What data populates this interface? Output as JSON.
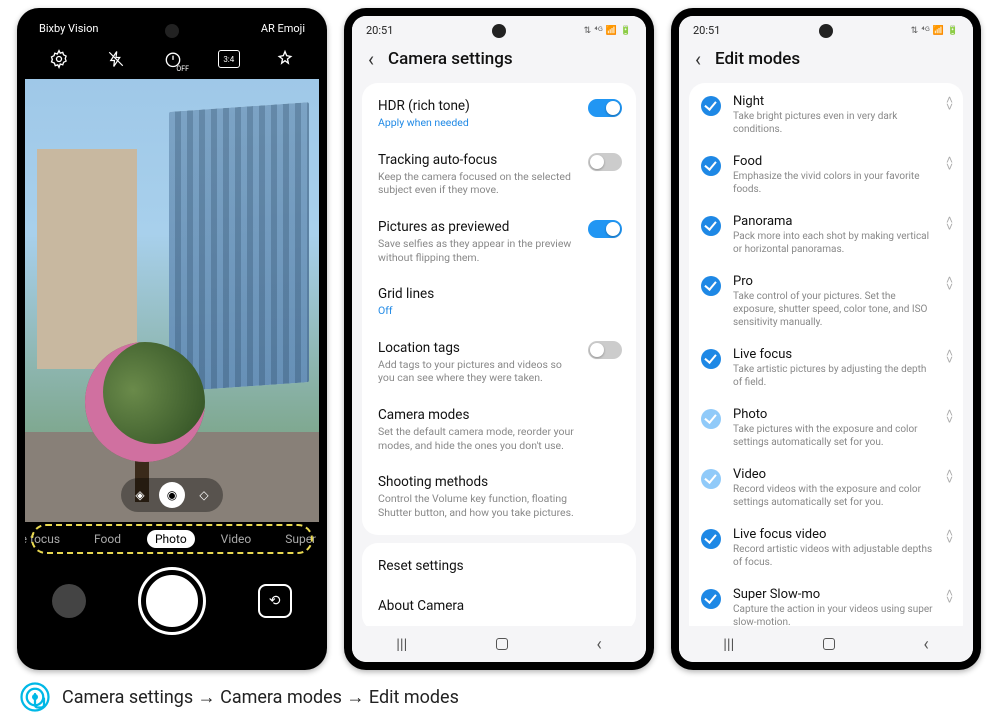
{
  "phone1": {
    "status": {
      "left": "Bixby Vision",
      "right": "AR Emoji"
    },
    "toolbar": {
      "i1": "settings-icon",
      "i2": "flash-off-icon",
      "i3": "timer-off-icon",
      "i4": "ratio-3-4-icon",
      "i5": "filters-icon",
      "ratio_label": "3:4",
      "timer_label": "OFF"
    },
    "modes": {
      "m1": "Live focus",
      "m2": "Food",
      "m3": "Photo",
      "m4": "Video",
      "m5": "Super Slow-mo",
      "selected": "Photo"
    }
  },
  "phone2": {
    "time": "20:51",
    "signal": "4G 📶 🔋",
    "title": "Camera settings",
    "rows": [
      {
        "label": "HDR (rich tone)",
        "sub": "Apply when needed",
        "sub_class": "blue",
        "toggle": "on"
      },
      {
        "label": "Tracking auto-focus",
        "sub": "Keep the camera focused on the selected subject even if they move.",
        "toggle": "off"
      },
      {
        "label": "Pictures as previewed",
        "sub": "Save selfies as they appear in the preview without flipping them.",
        "toggle": "on"
      },
      {
        "label": "Grid lines",
        "sub": "Off",
        "sub_class": "off"
      },
      {
        "label": "Location tags",
        "sub": "Add tags to your pictures and videos so you can see where they were taken.",
        "toggle": "off"
      },
      {
        "label": "Camera modes",
        "sub": "Set the default camera mode, reorder your modes, and hide the ones you don't use."
      },
      {
        "label": "Shooting methods",
        "sub": "Control the Volume key function, floating Shutter button, and how you take pictures."
      }
    ],
    "card2": [
      {
        "label": "Reset settings"
      },
      {
        "label": "About Camera"
      }
    ]
  },
  "phone3": {
    "time": "20:51",
    "signal": "4G 📶 🔋",
    "title": "Edit modes",
    "rows": [
      {
        "label": "Night",
        "sub": "Take bright pictures even in very dark conditions.",
        "dim": false
      },
      {
        "label": "Food",
        "sub": "Emphasize the vivid colors in your favorite foods.",
        "dim": false
      },
      {
        "label": "Panorama",
        "sub": "Pack more into each shot by making vertical or horizontal panoramas.",
        "dim": false
      },
      {
        "label": "Pro",
        "sub": "Take control of your pictures. Set the exposure, shutter speed, color tone, and ISO sensitivity manually.",
        "dim": false
      },
      {
        "label": "Live focus",
        "sub": "Take artistic pictures by adjusting the depth of field.",
        "dim": false
      },
      {
        "label": "Photo",
        "sub": "Take pictures with the exposure and color settings automatically set for you.",
        "dim": true
      },
      {
        "label": "Video",
        "sub": "Record videos with the exposure and color settings automatically set for you.",
        "dim": true
      },
      {
        "label": "Live focus video",
        "sub": "Record artistic videos with adjustable depths of focus.",
        "dim": false
      },
      {
        "label": "Super Slow-mo",
        "sub": "Capture the action in your videos using super slow-motion.",
        "dim": false
      }
    ]
  },
  "caption": "Camera settings → Camera modes → Edit modes"
}
